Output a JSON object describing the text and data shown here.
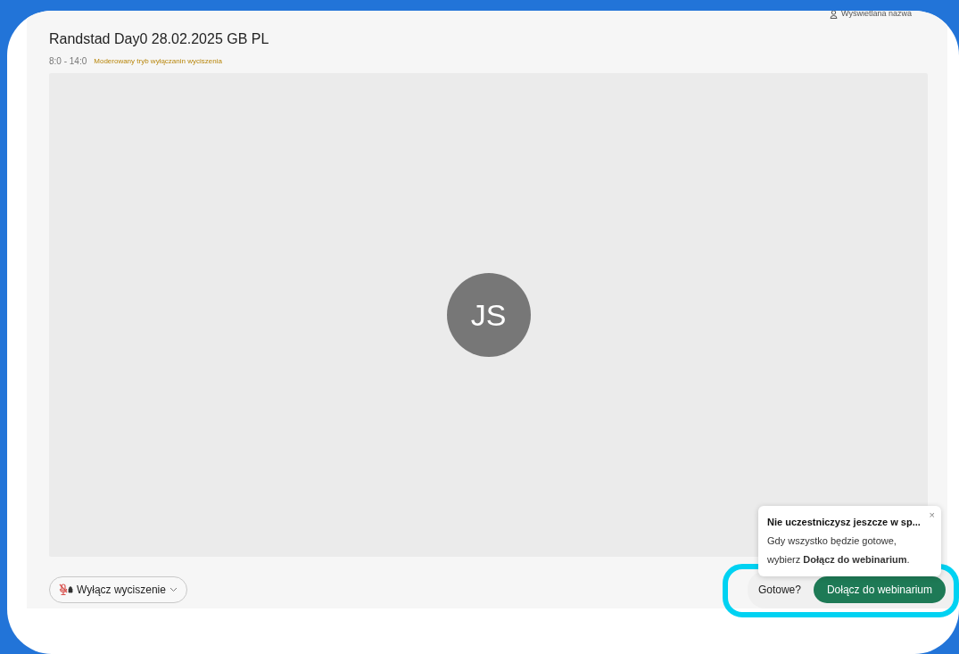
{
  "meeting": {
    "title": "Randstad Day0 28.02.2025 GB PL",
    "time": "8:0 - 14:0",
    "mode_notice": "Moderowany tryb wyłączanin wyciszenia"
  },
  "display_name": {
    "label": "Wyświetlana nazwa"
  },
  "participant": {
    "initials": "JS"
  },
  "unmute_button": {
    "label": "Wyłącz wyciszenie"
  },
  "tip": {
    "title": "Nie uczestniczysz jeszcze w sp...",
    "close": "×",
    "body": "Gdy wszystko będzie gotowe, wybierz **Dołącz do webinarium**."
  },
  "join_bar": {
    "prompt": "Gotowe?",
    "button": "Dołącz do webinarium",
    "highlighted": true
  }
}
